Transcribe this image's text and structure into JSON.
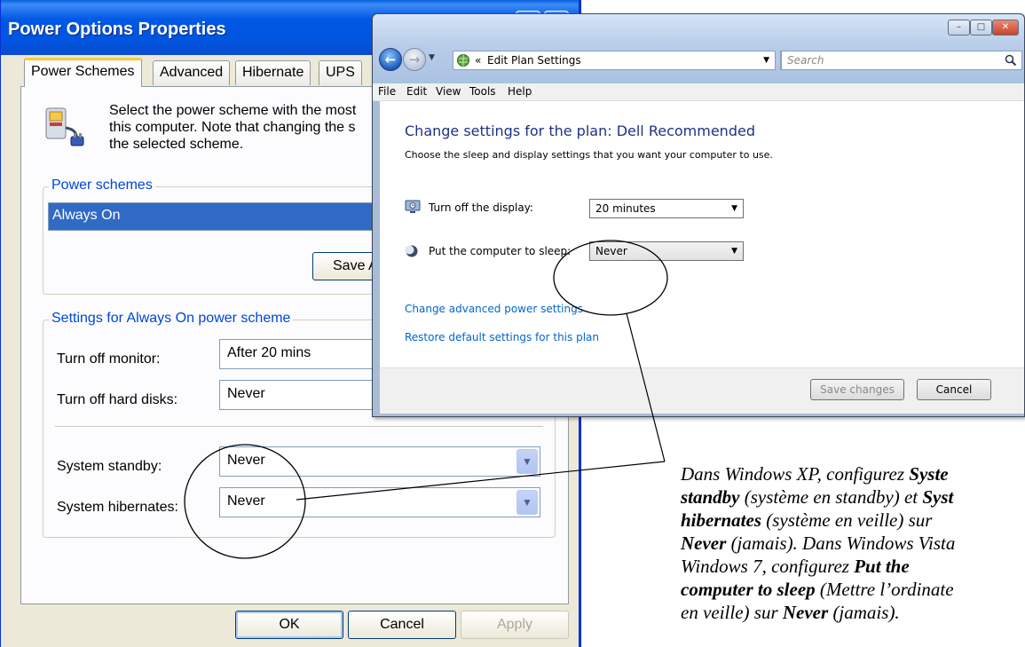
{
  "xp": {
    "title": "Power Options Properties",
    "tabs": [
      "Power Schemes",
      "Advanced",
      "Hibernate",
      "UPS"
    ],
    "intro_line1": "Select the power scheme with the most",
    "intro_line2": "this computer. Note that changing the s",
    "intro_line3": "the selected scheme.",
    "schemes_legend": "Power schemes",
    "scheme_selected": "Always On",
    "save_as_label": "Save A",
    "settings_legend": "Settings for Always On power scheme",
    "monitor_label": "Turn off monitor:",
    "monitor_value": "After 20 mins",
    "disks_label": "Turn off hard disks:",
    "disks_value": "Never",
    "standby_label": "System standby:",
    "standby_value": "Never",
    "hibernate_label": "System hibernates:",
    "hibernate_value": "Never",
    "ok_label": "OK",
    "cancel_label": "Cancel",
    "apply_label": "Apply"
  },
  "vista": {
    "breadcrumb_prefix": "«",
    "address": "Edit Plan Settings",
    "search_placeholder": "Search",
    "menu": [
      "File",
      "Edit",
      "View",
      "Tools",
      "Help"
    ],
    "heading": "Change settings for the plan: Dell Recommended",
    "subheading": "Choose the sleep and display settings that you want your computer to use.",
    "display_label": "Turn off the display:",
    "display_value": "20 minutes",
    "sleep_label": "Put the computer to sleep:",
    "sleep_value": "Never",
    "advanced_link": "Change advanced power settings",
    "restore_link": "Restore default settings for this plan",
    "save_label": "Save changes",
    "cancel_label": "Cancel"
  },
  "annotation": {
    "l1a": "Dans Windows XP, configurez ",
    "l1b": "Syste",
    "l2a": "standby",
    "l2b": " (système en standby) et ",
    "l2c": "Syst",
    "l3a": "hibernates",
    "l3b": " (système en veille) sur",
    "l4a": "Never",
    "l4b": " (jamais). Dans Windows Vista",
    "l5a": "Windows 7, configurez ",
    "l5b": "Put the",
    "l6a": "computer to sleep",
    "l6b": " (Mettre l’ordinate",
    "l7a": "en veille) sur ",
    "l7b": "Never",
    "l7c": " (jamais)."
  },
  "icons": [
    "power-plug-icon",
    "globe-icon",
    "moon-icon",
    "search-icon",
    "refresh-icon",
    "monitor-icon"
  ]
}
